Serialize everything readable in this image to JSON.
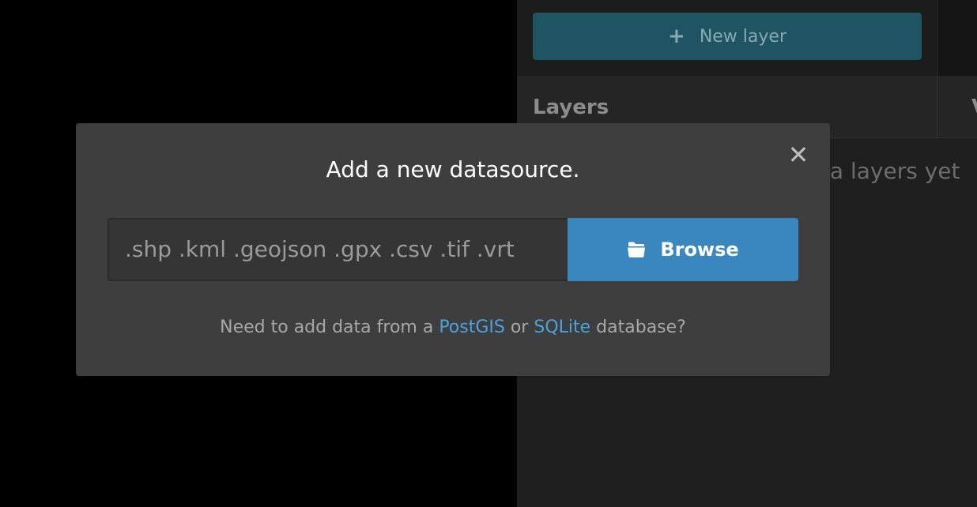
{
  "side_panel": {
    "new_layer_button": {
      "icon": "plus-icon",
      "label": "New layer"
    },
    "tabs": [
      {
        "label": "Layers"
      },
      {
        "label": "V"
      }
    ],
    "empty_message": "data layers yet"
  },
  "modal": {
    "title": "Add a new datasource.",
    "close_glyph": "✕",
    "file_input": {
      "placeholder": ".shp .kml .geojson .gpx .csv .tif .vrt"
    },
    "browse_button": {
      "icon": "folder-open-icon",
      "label": "Browse"
    },
    "footer": {
      "prefix": "Need to add data from a",
      "link_postgis": "PostGIS",
      "middle": "or",
      "link_sqlite": "SQLite",
      "suffix": "database?"
    }
  },
  "colors": {
    "backdrop": "#000000",
    "modal_bg": "#3e3e3e",
    "primary_button": "#3a87c0",
    "new_layer_button": "#1f5563",
    "link": "#4aa3dc"
  }
}
